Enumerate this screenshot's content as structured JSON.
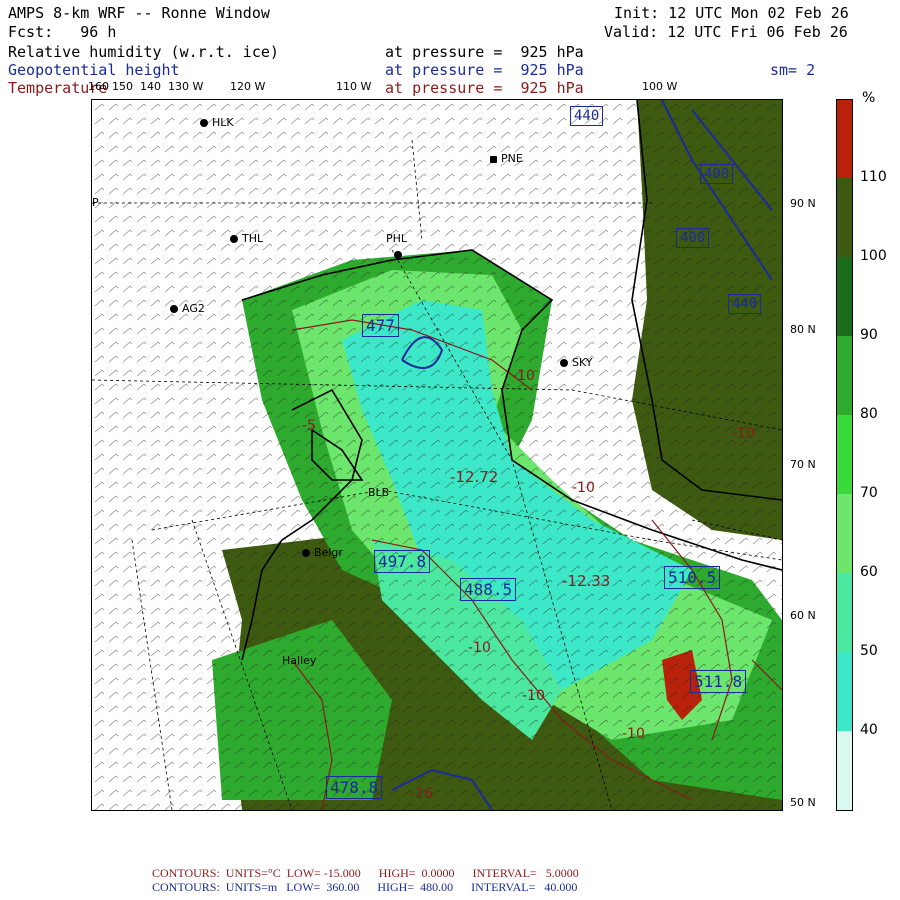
{
  "header": {
    "title": "AMPS 8-km WRF -- Ronne Window",
    "fcst_label": "Fcst:   96 h",
    "init": "Init: 12 UTC Mon 02 Feb 26",
    "valid": "Valid: 12 UTC Fri 06 Feb 26",
    "field1": "Relative humidity (w.r.t. ice)",
    "field2": "Geopotential height",
    "field3": "Temperature",
    "pressure": "at pressure =  925 hPa",
    "smoothing": "sm= 2"
  },
  "map": {
    "lon_labels": [
      "160",
      "150",
      "140",
      "130 W",
      "120 W",
      "110 W",
      "100 W"
    ],
    "lat_labels": [
      "90 N",
      "80 N",
      "70 N",
      "60 N",
      "50 N"
    ],
    "stations": [
      "HLK",
      "PNE",
      "THL",
      "PHL",
      "AG2",
      "SKY",
      "BLB",
      "Belgr",
      "Halley"
    ],
    "height_boxes": [
      "440",
      "400",
      "400",
      "440",
      "477",
      "497.8",
      "488.5",
      "510.5",
      "511.8",
      "478.8"
    ],
    "temp_labels": [
      "-10",
      "-10",
      "-5",
      "-10",
      "-12.33",
      "-12.72",
      "-10",
      "-10",
      "-10",
      "-16"
    ],
    "pole_label": "P"
  },
  "legend": {
    "unit": "%",
    "ticks": [
      "110",
      "100",
      "90",
      "80",
      "70",
      "60",
      "50",
      "40"
    ],
    "colors": [
      "#b8220a",
      "#3d5a10",
      "#1a6b1a",
      "#2eaa2e",
      "#3cd93c",
      "#6ce66c",
      "#4ce8a0",
      "#3ce8c8",
      "#d8f8f0"
    ]
  },
  "footer": {
    "line1": "CONTOURS:  UNITS=°C  LOW= -15.000      HIGH=  0.0000      INTERVAL=   5.0000",
    "line2": "CONTOURS:  UNITS=m   LOW=  360.00      HIGH=  480.00      INTERVAL=   40.000"
  }
}
